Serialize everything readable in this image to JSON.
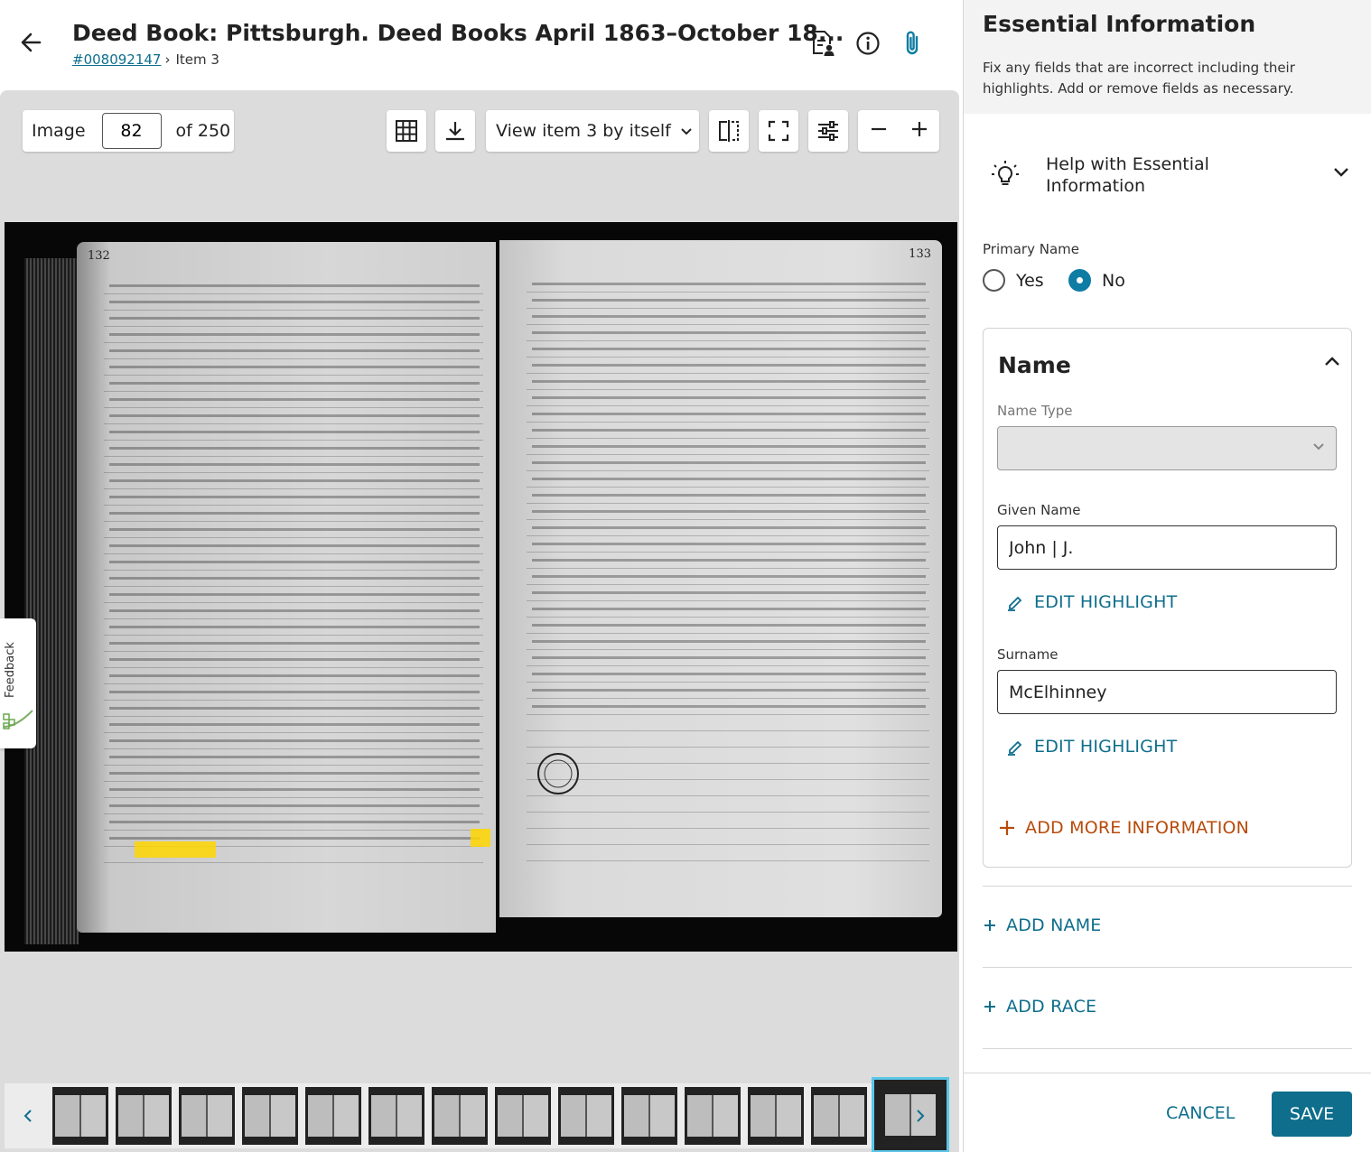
{
  "header": {
    "title": "Deed Book: Pittsburgh. Deed Books April 1863–October 18...",
    "film_number": "#008092147",
    "item_label": "Item 3"
  },
  "toolbar": {
    "image_label": "Image",
    "image_number": "82",
    "of_total": "of 250",
    "view_select": "View item 3 by itself"
  },
  "scan": {
    "page_left_number": "132",
    "page_right_number": "133"
  },
  "feedback": {
    "label": "Feedback"
  },
  "filmstrip": {
    "thumbnail_count": 14,
    "active_index": 13
  },
  "panel": {
    "title": "Essential Information",
    "description": "Fix any fields that are incorrect including their highlights. Add or remove fields as necessary.",
    "help_label": "Help with Essential Information",
    "primary_name": {
      "label": "Primary Name",
      "yes_label": "Yes",
      "no_label": "No",
      "selected": "No"
    },
    "name_card": {
      "title": "Name",
      "name_type_label": "Name Type",
      "name_type_value": "",
      "given_name_label": "Given Name",
      "given_name_value": "John | J.",
      "surname_label": "Surname",
      "surname_value": "McElhinney",
      "edit_highlight_label": "EDIT HIGHLIGHT",
      "add_more_label": "ADD MORE INFORMATION"
    },
    "add_name_label": "ADD NAME",
    "add_race_label": "ADD RACE",
    "cancel_label": "CANCEL",
    "save_label": "SAVE"
  },
  "colors": {
    "accent": "#0e6e8c",
    "radio_selected": "#0e7ca3",
    "add_more": "#b84a0a",
    "highlight": "#ffd600"
  }
}
